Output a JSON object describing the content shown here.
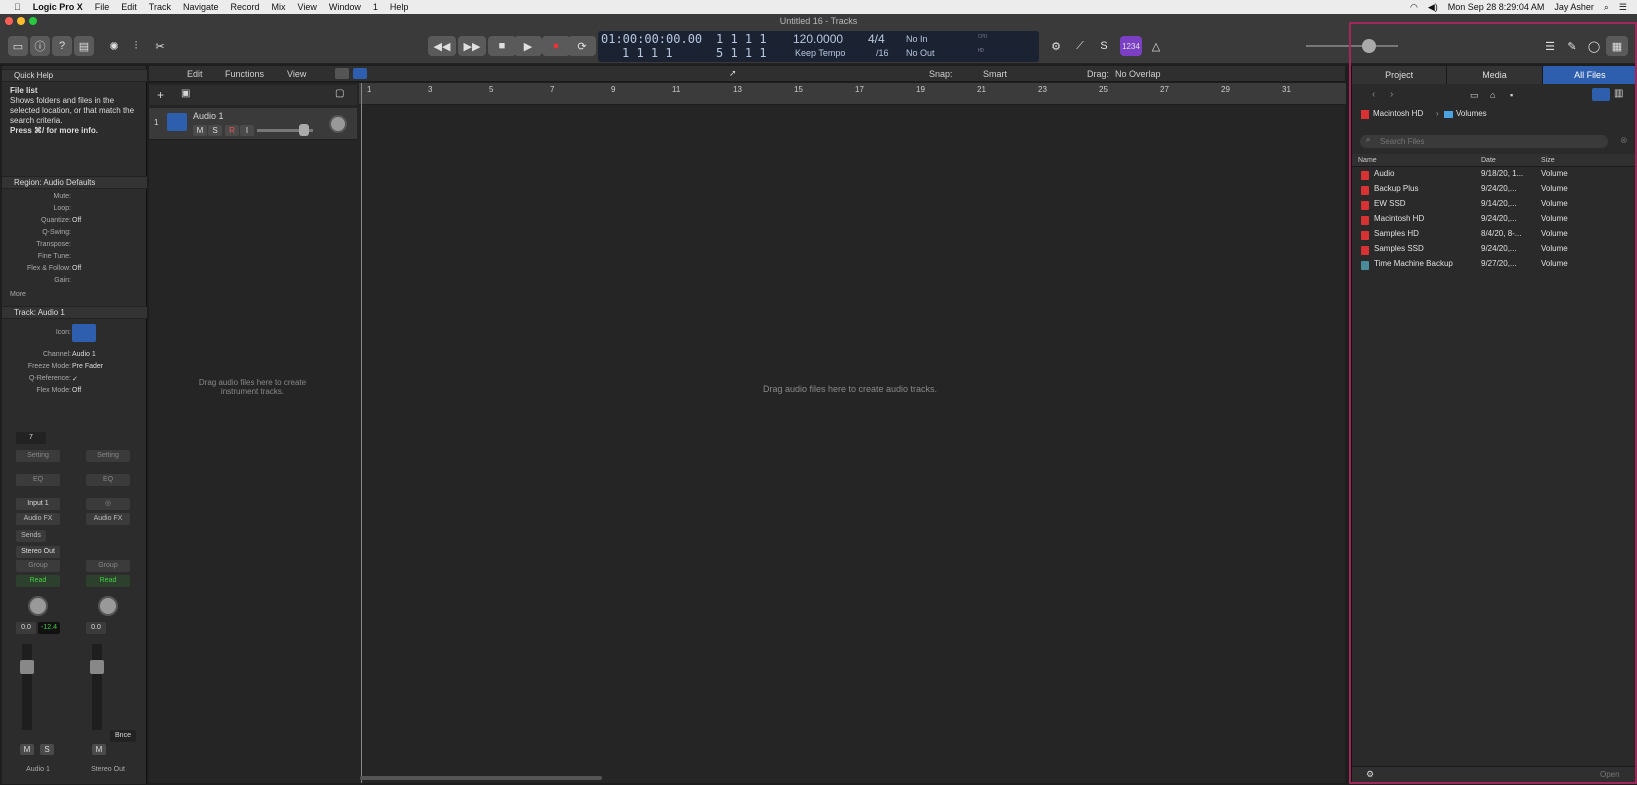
{
  "menubar": {
    "app": "Logic Pro X",
    "menus": [
      "File",
      "Edit",
      "Track",
      "Navigate",
      "Record",
      "Mix",
      "View",
      "Window",
      "1",
      "Help"
    ],
    "clock": "Mon Sep 28  8:29:04 AM",
    "user": "Jay Asher"
  },
  "window_title": "Untitled 16 - Tracks",
  "lcd": {
    "smpte": "01:00:00:00.00",
    "bars_top": "1 1 1 1",
    "bars_bottom": "1 1 1 1",
    "bars2_top": "1 1 1 1",
    "bars2_bottom": "5 1 1 1",
    "tempo": "120.0000",
    "tempo_mode": "Keep Tempo",
    "sig": "4/4",
    "div": "/16",
    "in": "No In",
    "out": "No Out",
    "cpu": "CPU",
    "hd": "HD"
  },
  "key_badge": "1234",
  "track_header": {
    "edit": "Edit",
    "functions": "Functions",
    "view": "View",
    "snap_label": "Snap:",
    "snap_value": "Smart",
    "drag_label": "Drag:",
    "drag_value": "No Overlap"
  },
  "ruler": [
    "1",
    "3",
    "5",
    "7",
    "9",
    "11",
    "13",
    "15",
    "17",
    "19",
    "21",
    "23",
    "25",
    "27",
    "29",
    "31"
  ],
  "track": {
    "num": "1",
    "name": "Audio 1",
    "m": "M",
    "s": "S",
    "r": "R",
    "i": "I"
  },
  "empty_left": "Drag audio files here to create instrument tracks.",
  "empty_main": "Drag audio files here to create audio tracks.",
  "quickhelp": {
    "title": "Quick Help",
    "heading": "File list",
    "body": "Shows folders and files in the selected location, or that match the search criteria.",
    "more": "Press ⌘/ for more info."
  },
  "region": {
    "title": "Region: Audio Defaults",
    "rows": [
      [
        "Mute:",
        ""
      ],
      [
        "Loop:",
        ""
      ],
      [
        "Quantize:",
        "Off"
      ],
      [
        "Q-Swing:",
        ""
      ],
      [
        "Transpose:",
        ""
      ],
      [
        "Fine Tune:",
        ""
      ],
      [
        "Flex & Follow:",
        "Off"
      ],
      [
        "Gain:",
        ""
      ]
    ],
    "more": "More"
  },
  "track_insp": {
    "title": "Track:  Audio 1",
    "icon": "Icon:",
    "rows": [
      [
        "Channel:",
        "Audio 1"
      ],
      [
        "Freeze Mode:",
        "Pre Fader"
      ],
      [
        "Q-Reference:",
        "✓"
      ],
      [
        "Flex Mode:",
        "Off"
      ]
    ]
  },
  "strip1": {
    "input_num": "7",
    "setting": "Setting",
    "eq": "EQ",
    "input": "Input 1",
    "afx": "Audio FX",
    "sends": "Sends",
    "out": "Stereo Out",
    "group": "Group",
    "read": "Read",
    "vol": "0.0",
    "peak": "-12.4",
    "m": "M",
    "s": "S",
    "name": "Audio 1"
  },
  "strip2": {
    "setting": "Setting",
    "eq": "EQ",
    "afx": "Audio FX",
    "group": "Group",
    "read": "Read",
    "vol": "0.0",
    "bnce": "Bnce",
    "m": "M",
    "name": "Stereo Out"
  },
  "browser": {
    "tabs": [
      "Project",
      "Media",
      "All Files"
    ],
    "path1": "Macintosh HD",
    "path2": "Volumes",
    "search_placeholder": "Search Files",
    "cols": [
      "Name",
      "Date",
      "Size"
    ],
    "files": [
      [
        "Audio",
        "9/18/20, 1...",
        "Volume"
      ],
      [
        "Backup Plus",
        "9/24/20,...",
        "Volume"
      ],
      [
        "EW SSD",
        "9/14/20,...",
        "Volume"
      ],
      [
        "Macintosh HD",
        "9/24/20,...",
        "Volume"
      ],
      [
        "Samples HD",
        "8/4/20, 8-...",
        "Volume"
      ],
      [
        "Samples SSD",
        "9/24/20,...",
        "Volume"
      ],
      [
        "Time Machine Backup",
        "9/27/20,...",
        "Volume"
      ]
    ],
    "open": "Open"
  },
  "colors": {
    "accent": "#2e5fae",
    "highlight": "#a0295c",
    "record": "#d93232",
    "purple": "#7b3fc4"
  }
}
